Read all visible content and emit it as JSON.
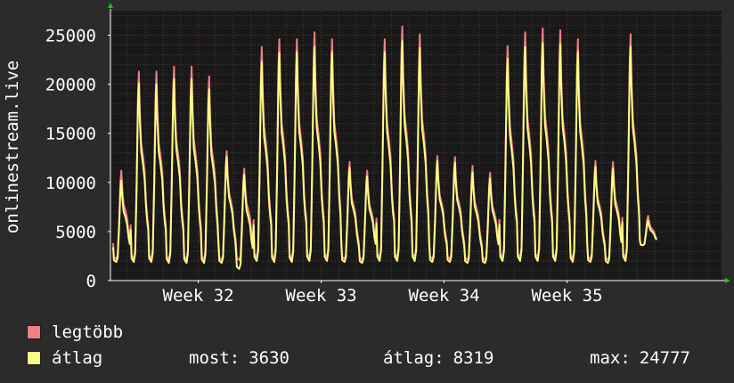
{
  "chart_data": {
    "type": "line",
    "ylabel": "onlinestream.live",
    "yticks": [
      0,
      5000,
      10000,
      15000,
      20000,
      25000
    ],
    "ylim": [
      0,
      27500
    ],
    "xlim": [
      0,
      34.8
    ],
    "xticks": [
      {
        "label": "Week 32",
        "x": 5.0
      },
      {
        "label": "Week 33",
        "x": 12.0
      },
      {
        "label": "Week 34",
        "x": 19.0
      },
      {
        "label": "Week 35",
        "x": 26.0
      }
    ],
    "grid": true,
    "series": [
      {
        "name": "legtöbb",
        "color": "#f07f83",
        "daily_peaks": [
          11200,
          21300,
          21300,
          21800,
          21800,
          20800,
          13200,
          11400,
          23800,
          24600,
          24600,
          25300,
          24600,
          12100,
          11200,
          24600,
          25900,
          25100,
          12700,
          12600,
          11700,
          11000,
          23900,
          25300,
          25700,
          25500,
          24600,
          12200,
          12100,
          25100,
          6600
        ],
        "daily_mins": [
          2200,
          2200,
          2200,
          2100,
          2100,
          2100,
          2100,
          2100,
          2300,
          2200,
          2200,
          2300,
          2300,
          2200,
          2100,
          2300,
          2300,
          2300,
          2200,
          2200,
          2100,
          2100,
          2300,
          2300,
          2300,
          2300,
          2200,
          2200,
          2100,
          2300,
          3600
        ]
      },
      {
        "name": "átlag",
        "color": "#fbfb82",
        "daily_peaks": [
          10200,
          20100,
          20000,
          20500,
          20500,
          19500,
          12600,
          10800,
          22300,
          23200,
          23300,
          23800,
          23300,
          11500,
          10600,
          23300,
          24400,
          23700,
          12200,
          12000,
          11000,
          10400,
          22600,
          23800,
          24200,
          24100,
          23300,
          11600,
          11400,
          23800,
          6100
        ],
        "daily_mins": [
          1900,
          1900,
          1900,
          1800,
          1800,
          1800,
          1800,
          1200,
          2000,
          1900,
          1900,
          2000,
          2000,
          1900,
          1800,
          2000,
          2000,
          2000,
          1900,
          1900,
          1800,
          1800,
          2000,
          2000,
          2000,
          2000,
          1900,
          1900,
          1800,
          2000,
          3600
        ]
      }
    ]
  },
  "legend": {
    "items": [
      {
        "label": "legtöbb",
        "color": "#f07f83"
      },
      {
        "label": "átlag",
        "color": "#fbfb82"
      }
    ],
    "stats": {
      "most_label": "most:",
      "most_value": "3630",
      "avg_label": "átlag:",
      "avg_value": "8319",
      "max_label": "max:",
      "max_value": "24777"
    }
  },
  "colors": {
    "background": "#2b2b2b",
    "plot_background": "#191919",
    "grid_major": "#7a2828",
    "grid_minor": "#3c3c3c",
    "axis": "#ffffff",
    "arrow": "#00d200"
  }
}
